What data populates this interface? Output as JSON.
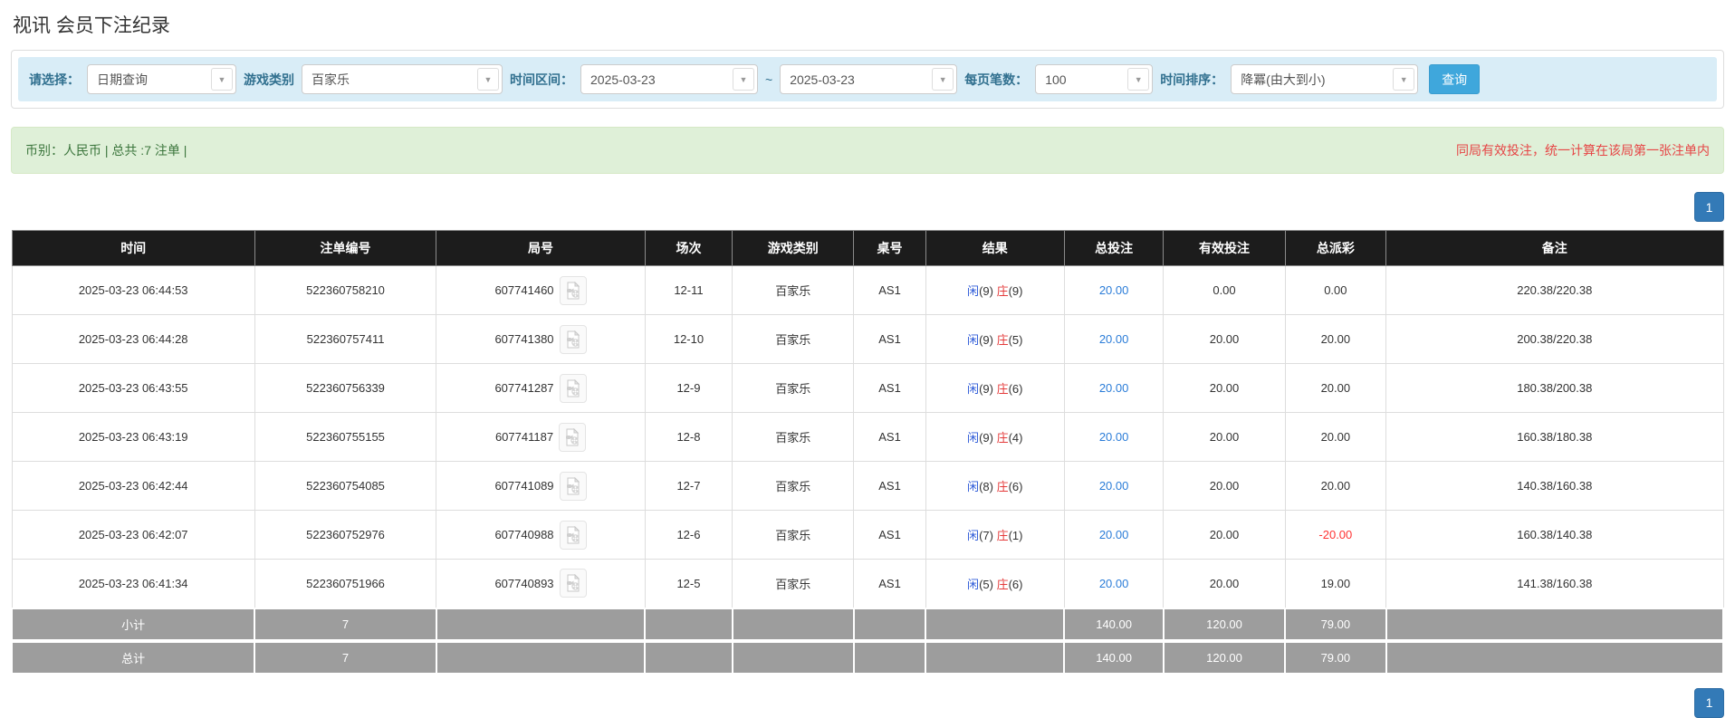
{
  "page": {
    "title": "视讯 会员下注纪录"
  },
  "filters": {
    "select_label": "请选择：",
    "select_value": "日期查询",
    "game_label": "游戏类别",
    "game_value": "百家乐",
    "range_label": "时间区间：",
    "date_from": "2025-03-23",
    "tilde": "~",
    "date_to": "2025-03-23",
    "per_page_label": "每页笔数：",
    "per_page_value": "100",
    "sort_label": "时间排序：",
    "sort_value": "降冪(由大到小)",
    "search_button": "查询",
    "caret_icon": "▼"
  },
  "summary": {
    "left_text": "币别：人民币 | 总共 :7 注单 |",
    "right_note": "同局有效投注，统一计算在该局第一张注单内"
  },
  "pagination": {
    "page": "1"
  },
  "table": {
    "headers": [
      "时间",
      "注单编号",
      "局号",
      "场次",
      "游戏类别",
      "桌号",
      "结果",
      "总投注",
      "有效投注",
      "总派彩",
      "备注"
    ],
    "result_labels": {
      "player": "闲",
      "banker": "庄"
    },
    "rows": [
      {
        "time": "2025-03-23 06:44:53",
        "bet_no": "522360758210",
        "round_no": "607741460",
        "session": "12-11",
        "game": "百家乐",
        "table_no": "AS1",
        "player_score": "9",
        "banker_score": "9",
        "total_bet": "20.00",
        "valid_bet": "0.00",
        "payout": "0.00",
        "note": "220.38/220.38"
      },
      {
        "time": "2025-03-23 06:44:28",
        "bet_no": "522360757411",
        "round_no": "607741380",
        "session": "12-10",
        "game": "百家乐",
        "table_no": "AS1",
        "player_score": "9",
        "banker_score": "5",
        "total_bet": "20.00",
        "valid_bet": "20.00",
        "payout": "20.00",
        "note": "200.38/220.38"
      },
      {
        "time": "2025-03-23 06:43:55",
        "bet_no": "522360756339",
        "round_no": "607741287",
        "session": "12-9",
        "game": "百家乐",
        "table_no": "AS1",
        "player_score": "9",
        "banker_score": "6",
        "total_bet": "20.00",
        "valid_bet": "20.00",
        "payout": "20.00",
        "note": "180.38/200.38"
      },
      {
        "time": "2025-03-23 06:43:19",
        "bet_no": "522360755155",
        "round_no": "607741187",
        "session": "12-8",
        "game": "百家乐",
        "table_no": "AS1",
        "player_score": "9",
        "banker_score": "4",
        "total_bet": "20.00",
        "valid_bet": "20.00",
        "payout": "20.00",
        "note": "160.38/180.38"
      },
      {
        "time": "2025-03-23 06:42:44",
        "bet_no": "522360754085",
        "round_no": "607741089",
        "session": "12-7",
        "game": "百家乐",
        "table_no": "AS1",
        "player_score": "8",
        "banker_score": "6",
        "total_bet": "20.00",
        "valid_bet": "20.00",
        "payout": "20.00",
        "note": "140.38/160.38"
      },
      {
        "time": "2025-03-23 06:42:07",
        "bet_no": "522360752976",
        "round_no": "607740988",
        "session": "12-6",
        "game": "百家乐",
        "table_no": "AS1",
        "player_score": "7",
        "banker_score": "1",
        "total_bet": "20.00",
        "valid_bet": "20.00",
        "payout": "-20.00",
        "note": "160.38/140.38"
      },
      {
        "time": "2025-03-23 06:41:34",
        "bet_no": "522360751966",
        "round_no": "607740893",
        "session": "12-5",
        "game": "百家乐",
        "table_no": "AS1",
        "player_score": "5",
        "banker_score": "6",
        "total_bet": "20.00",
        "valid_bet": "20.00",
        "payout": "19.00",
        "note": "141.38/160.38"
      }
    ],
    "subtotal": {
      "label": "小计",
      "count": "7",
      "total_bet": "140.00",
      "valid_bet": "120.00",
      "payout": "79.00"
    },
    "total": {
      "label": "总计",
      "count": "7",
      "total_bet": "140.00",
      "valid_bet": "120.00",
      "payout": "79.00"
    }
  },
  "icons": {
    "video_replay": "video-replay-icon"
  },
  "colors": {
    "accent_blue": "#337ab7",
    "search_button_blue": "#3fa7dc",
    "filter_bg": "#d9edf7",
    "filter_label": "#31708f",
    "summary_bg": "#dff0d8",
    "summary_text": "#3c763d",
    "note_red": "#e64545",
    "player_blue": "#2e5bd8",
    "banker_red": "#e43b3b",
    "bet_link_blue": "#2a7cd8",
    "negative_red": "#ff3333",
    "header_bg": "#1c1c1c",
    "footer_bg": "#9d9d9d"
  }
}
